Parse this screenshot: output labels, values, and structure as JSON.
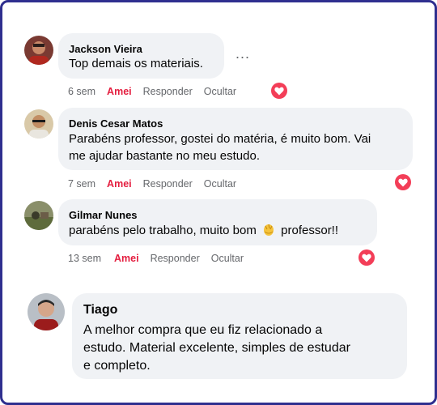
{
  "comments": [
    {
      "author": "Jackson Vieira",
      "text": "Top demais os materiais.",
      "time": "6 sem",
      "reaction_label": "Amei",
      "reply_label": "Responder",
      "hide_label": "Ocultar",
      "reaction_icon": "heart-icon"
    },
    {
      "author": "Denis Cesar Matos",
      "text_line1": "Parabéns professor, gostei do matéria, é muito bom. Vai",
      "text_line2": "me ajudar bastante no meu estudo.",
      "time": "7 sem",
      "reaction_label": "Amei",
      "reply_label": "Responder",
      "hide_label": "Ocultar",
      "reaction_icon": "heart-icon"
    },
    {
      "author": "Gilmar Nunes",
      "text_before": "parabéns pelo trabalho, muito bom",
      "text_after": "professor!!",
      "emoji": "clapping-hands-emoji",
      "time": "13 sem",
      "reaction_label": "Amei",
      "reply_label": "Responder",
      "hide_label": "Ocultar",
      "reaction_icon": "heart-icon"
    }
  ],
  "featured": {
    "author": "Tiago",
    "text_line1": "A melhor compra que eu fiz relacionado a",
    "text_line2": "estudo. Material excelente, simples de estudar",
    "text_line3": "e completo."
  },
  "more_options": "...",
  "colors": {
    "border": "#2f2f8f",
    "bubble": "#f0f2f5",
    "love": "#e41e3f",
    "heart": "#f33e58",
    "meta": "#65676b"
  }
}
